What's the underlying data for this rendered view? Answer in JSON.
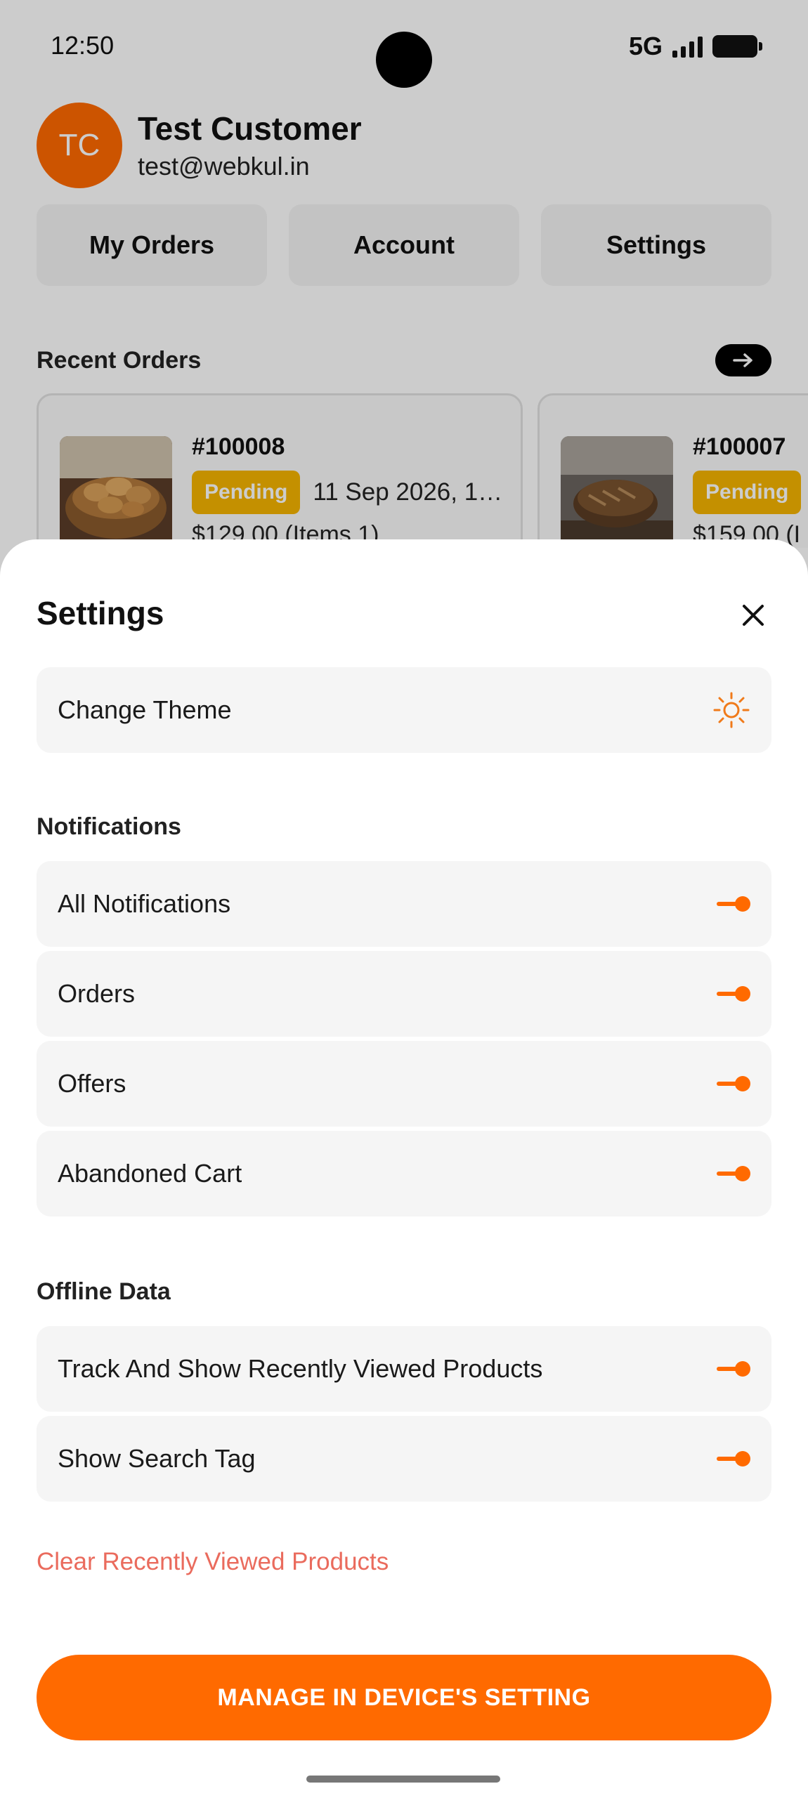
{
  "status_bar": {
    "time": "12:50",
    "network": "5G"
  },
  "profile": {
    "initials": "TC",
    "name": "Test Customer",
    "email": "test@webkul.in",
    "avatar_color": "#ff6a00"
  },
  "quick_actions": [
    {
      "label": "My Orders"
    },
    {
      "label": "Account"
    },
    {
      "label": "Settings"
    }
  ],
  "recent_orders": {
    "title": "Recent Orders",
    "orders": [
      {
        "id": "#100008",
        "status": "Pending",
        "date": "11 Sep 2026, 1…",
        "price": "$129.00 (Items 1)",
        "thumbnail": "bread-rolls-basket"
      },
      {
        "id": "#100007",
        "status": "Pending",
        "date": "",
        "price": "$159.00 (I",
        "thumbnail": "sourdough-loaf"
      }
    ]
  },
  "settings_sheet": {
    "title": "Settings",
    "theme_row": {
      "label": "Change Theme",
      "icon": "sun-icon"
    },
    "notifications": {
      "title": "Notifications",
      "items": [
        {
          "label": "All Notifications",
          "enabled": true
        },
        {
          "label": "Orders",
          "enabled": true
        },
        {
          "label": "Offers",
          "enabled": true
        },
        {
          "label": "Abandoned Cart",
          "enabled": true
        }
      ]
    },
    "offline_data": {
      "title": "Offline Data",
      "items": [
        {
          "label": "Track And Show Recently Viewed Products",
          "enabled": true
        },
        {
          "label": "Show Search Tag",
          "enabled": true
        }
      ]
    },
    "clear_link": "Clear Recently Viewed Products",
    "manage_button": "MANAGE IN DEVICE'S SETTING"
  },
  "colors": {
    "accent": "#ff6a00",
    "pending": "#f5b400",
    "danger_link": "#ea6b5d",
    "row_bg": "#f5f5f5"
  }
}
